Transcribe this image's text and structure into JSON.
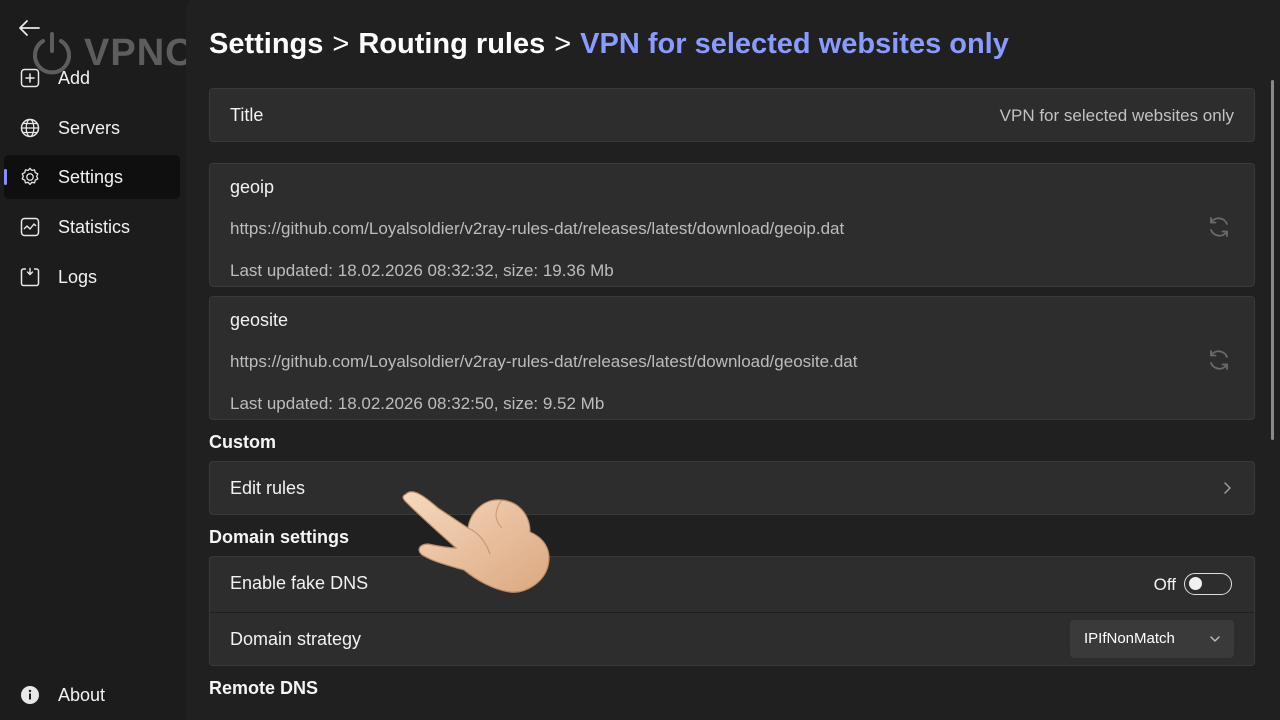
{
  "sidebar": {
    "logo_text": "VPNON",
    "items": [
      {
        "label": "Add",
        "icon": "add-icon"
      },
      {
        "label": "Servers",
        "icon": "globe-icon"
      },
      {
        "label": "Settings",
        "icon": "gear-icon",
        "active": true
      },
      {
        "label": "Statistics",
        "icon": "chart-icon"
      },
      {
        "label": "Logs",
        "icon": "logs-icon"
      }
    ],
    "about": {
      "label": "About",
      "icon": "info-icon"
    }
  },
  "breadcrumb": {
    "parts": [
      "Settings",
      "Routing rules"
    ],
    "separator": ">",
    "current": "VPN for selected websites only"
  },
  "title_row": {
    "label": "Title",
    "value": "VPN for selected websites only"
  },
  "geo_files": [
    {
      "name": "geoip",
      "url": "https://github.com/Loyalsoldier/v2ray-rules-dat/releases/latest/download/geoip.dat",
      "status": "Last updated: 18.02.2026 08:32:32, size: 19.36 Mb"
    },
    {
      "name": "geosite",
      "url": "https://github.com/Loyalsoldier/v2ray-rules-dat/releases/latest/download/geosite.dat",
      "status": "Last updated: 18.02.2026 08:32:50, size: 9.52 Mb"
    }
  ],
  "custom": {
    "section_title": "Custom",
    "edit_rules_label": "Edit rules"
  },
  "domain_settings": {
    "section_title": "Domain settings",
    "fake_dns": {
      "label": "Enable fake DNS",
      "state_label": "Off",
      "enabled": false
    },
    "strategy": {
      "label": "Domain strategy",
      "value": "IPIfNonMatch"
    }
  },
  "remote_dns": {
    "section_title": "Remote DNS"
  },
  "colors": {
    "accent": "#8a9bff",
    "sidebar_indicator": "#8a8ff7",
    "card_bg": "#2d2d2d",
    "app_bg": "#1c1c1c"
  }
}
